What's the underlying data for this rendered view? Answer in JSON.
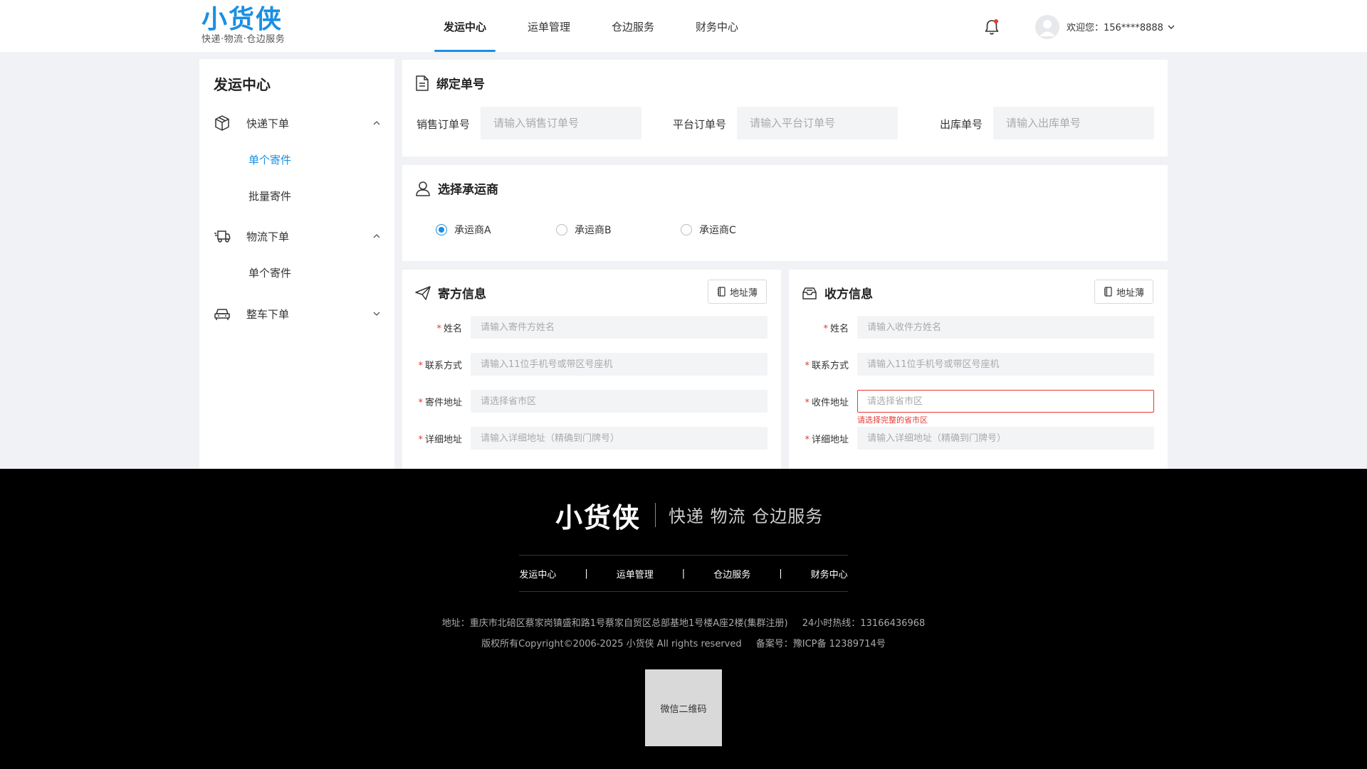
{
  "header": {
    "logo_title": "小货侠",
    "logo_subtitle": "快递·物流·仓边服务",
    "nav": [
      {
        "label": "发运中心",
        "active": true
      },
      {
        "label": "运单管理",
        "active": false
      },
      {
        "label": "仓边服务",
        "active": false
      },
      {
        "label": "财务中心",
        "active": false
      }
    ],
    "user_greeting": "欢迎您：156****8888"
  },
  "sidebar": {
    "title": "发运中心",
    "groups": [
      {
        "label": "快递下单",
        "icon": "package-icon",
        "expanded": true,
        "subs": [
          {
            "label": "单个寄件",
            "active": true
          },
          {
            "label": "批量寄件",
            "active": false
          }
        ]
      },
      {
        "label": "物流下单",
        "icon": "truck-icon",
        "expanded": true,
        "subs": [
          {
            "label": "单个寄件",
            "active": false
          }
        ]
      },
      {
        "label": "整车下单",
        "icon": "vehicle-icon",
        "expanded": false,
        "subs": []
      }
    ]
  },
  "bind_order": {
    "title": "绑定单号",
    "fields": [
      {
        "label": "销售订单号",
        "placeholder": "请输入销售订单号",
        "value": ""
      },
      {
        "label": "平台订单号",
        "placeholder": "请输入平台订单号",
        "value": ""
      },
      {
        "label": "出库单号",
        "placeholder": "请输入出库单号",
        "value": ""
      }
    ]
  },
  "carrier": {
    "title": "选择承运商",
    "options": [
      {
        "label": "承运商A",
        "checked": true
      },
      {
        "label": "承运商B",
        "checked": false
      },
      {
        "label": "承运商C",
        "checked": false
      }
    ]
  },
  "sender": {
    "title": "寄方信息",
    "address_book": "地址薄",
    "fields": [
      {
        "label": "姓名",
        "placeholder": "请输入寄件方姓名"
      },
      {
        "label": "联系方式",
        "placeholder": "请输入11位手机号或带区号座机"
      },
      {
        "label": "寄件地址",
        "placeholder": "请选择省市区"
      },
      {
        "label": "详细地址",
        "placeholder": "请输入详细地址（精确到门牌号）"
      }
    ]
  },
  "receiver": {
    "title": "收方信息",
    "address_book": "地址薄",
    "fields": [
      {
        "label": "姓名",
        "placeholder": "请输入收件方姓名"
      },
      {
        "label": "联系方式",
        "placeholder": "请输入11位手机号或带区号座机"
      },
      {
        "label": "收件地址",
        "placeholder": "请选择省市区",
        "error": "请选择完整的省市区"
      },
      {
        "label": "详细地址",
        "placeholder": "请输入详细地址（精确到门牌号）"
      }
    ]
  },
  "footer": {
    "logo": "小货侠",
    "slogan": "快递 物流 仓边服务",
    "nav": [
      "发运中心",
      "运单管理",
      "仓边服务",
      "财务中心"
    ],
    "address": "地址：重庆市北碚区蔡家岗镇盛和路1号蔡家自贸区总部基地1号楼A座2楼(集群注册)",
    "hotline": "24小时热线：13166436968",
    "copyright": "版权所有Copyright©2006-2025 小货侠 All rights reserved",
    "icp": "备案号：豫ICP备 12389714号",
    "qr_label": "微信二维码"
  },
  "colors": {
    "accent": "#1a8fe3",
    "error": "#e53935",
    "footer_bg": "#000000",
    "page_bg": "#f0f2f5"
  }
}
